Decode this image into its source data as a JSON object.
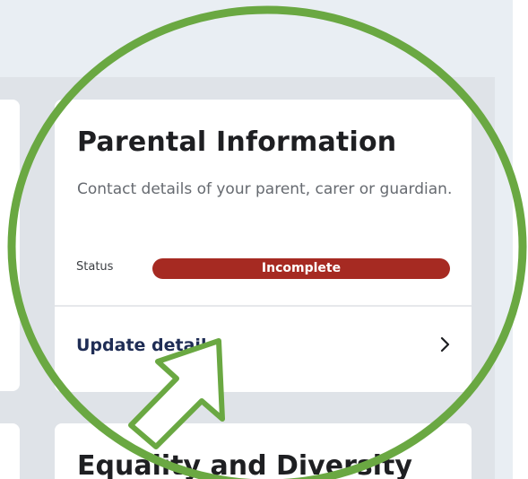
{
  "parental_card": {
    "title": "Parental Information",
    "description": "Contact details of your parent, carer or guardian.",
    "status_label": "Status",
    "status_value": "Incomplete",
    "action_label": "Update details",
    "action_icon": "chevron-right-icon"
  },
  "next_card": {
    "title": "Equality and Diversity"
  },
  "annotation": {
    "circle_color": "#6aa842",
    "arrow_fill": "#ffffff",
    "arrow_stroke": "#6aa842",
    "arrow_icon": "pointer-arrow-icon"
  },
  "colors": {
    "status_incomplete": "#a62a22",
    "link_text": "#1f2d55",
    "page_bg": "#e9eef3"
  }
}
